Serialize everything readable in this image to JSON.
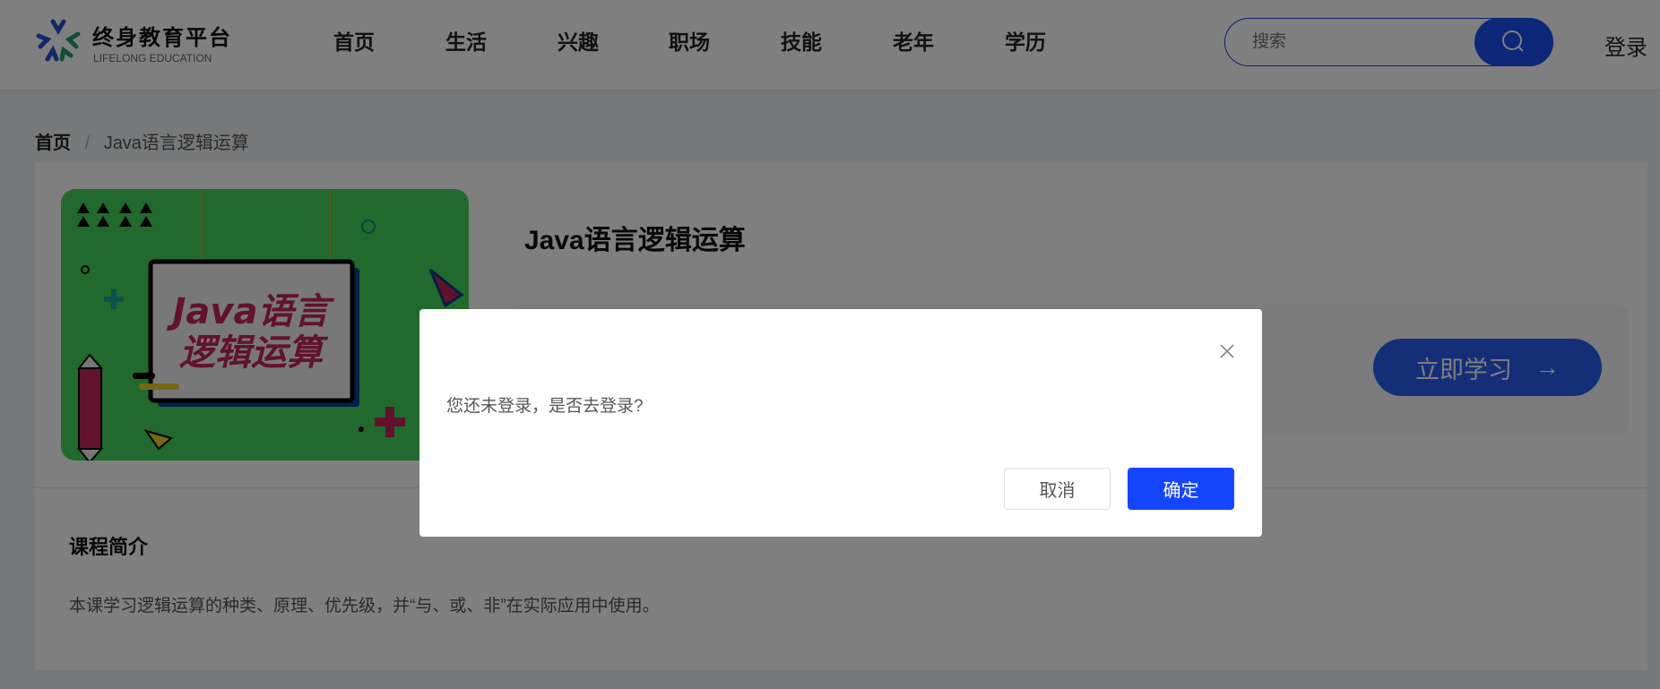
{
  "header": {
    "logo_title": "终身教育平台",
    "logo_subtitle": "LIFELONG EDUCATION",
    "nav": [
      "首页",
      "生活",
      "兴趣",
      "职场",
      "技能",
      "老年",
      "学历"
    ],
    "search_placeholder": "搜索",
    "login": "登录"
  },
  "breadcrumb": {
    "home": "首页",
    "separator": "/",
    "current": "Java语言逻辑运算"
  },
  "course": {
    "title": "Java语言逻辑运算",
    "cover_text": [
      "Java语言",
      "逻辑运算"
    ],
    "study_button": "立即学习",
    "study_arrow": "→",
    "intro_heading": "课程简介",
    "intro_text": "本课学习逻辑运算的种类、原理、优先级，并“与、或、非”在实际应用中使用。"
  },
  "dialog": {
    "message": "您还未登录，是否去登录?",
    "cancel": "取消",
    "confirm": "确定"
  },
  "colors": {
    "primary": "#1546ff",
    "cover_green": "#43d35a",
    "cover_red": "#c2265a"
  }
}
